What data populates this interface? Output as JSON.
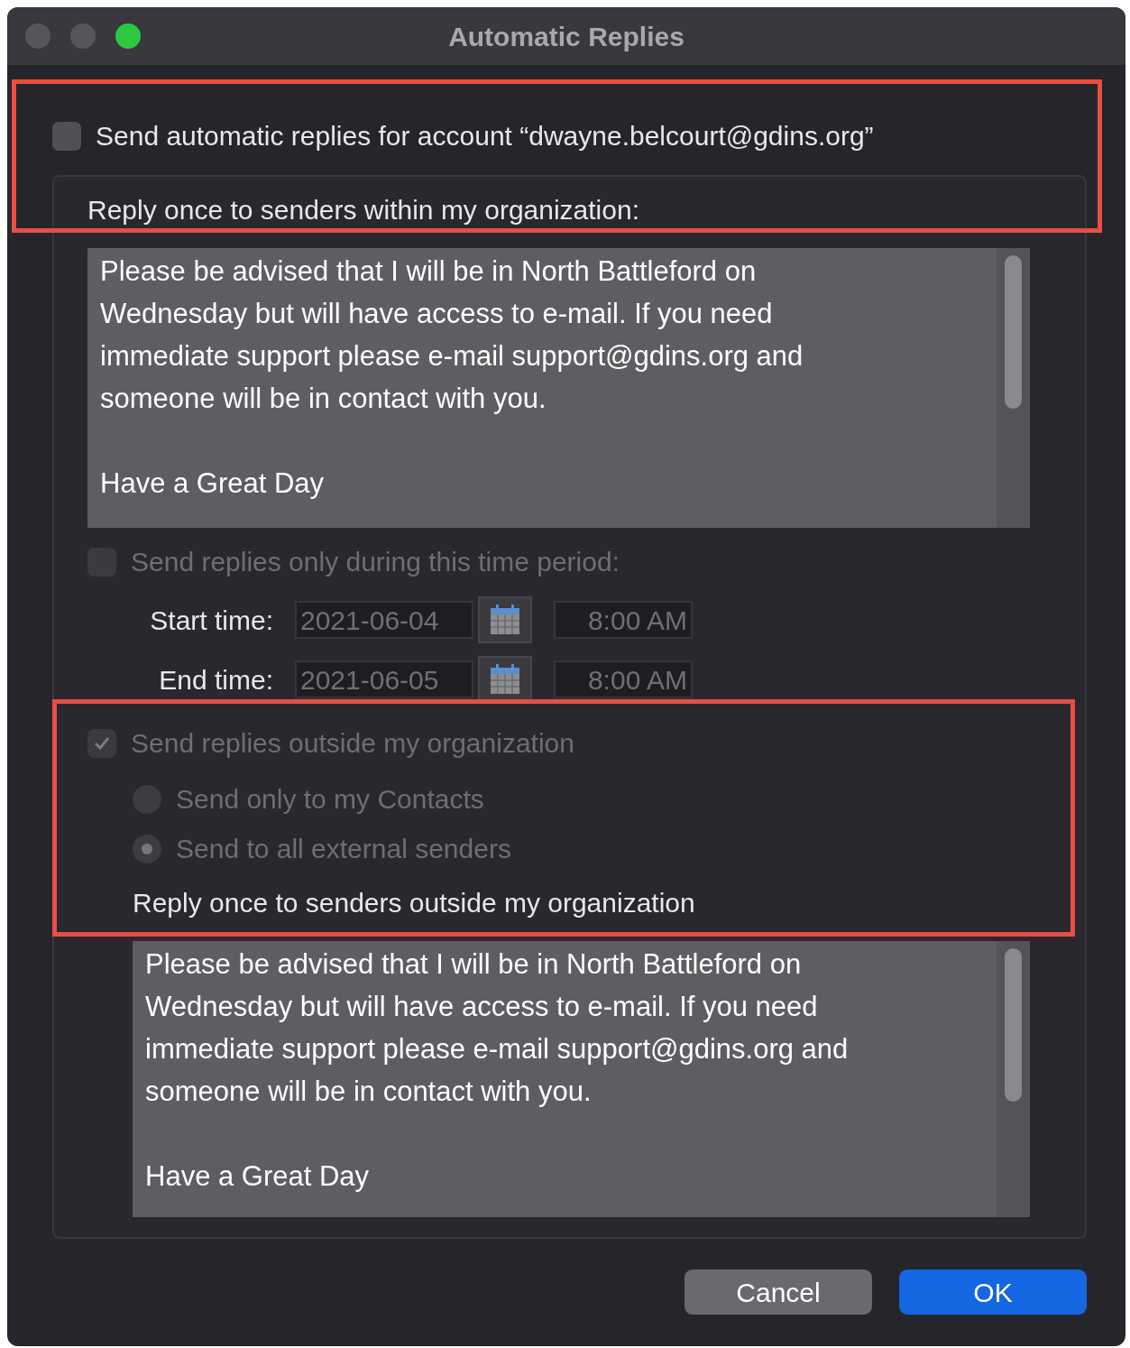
{
  "window": {
    "title": "Automatic Replies"
  },
  "send_automatic": {
    "label": "Send automatic replies for account “dwayne.belcourt@gdins.org”",
    "checked": false
  },
  "internal": {
    "label": "Reply once to senders within my organization:",
    "message": [
      "Please be advised that I will be in North Battleford on\nWednesday but will have access to e-mail. If you need\nimmediate support please e-mail support@gdins.org and\nsomeone will be in contact with you.",
      "Have a Great Day"
    ]
  },
  "time_period": {
    "label": "Send replies only during this time period:",
    "checked": false,
    "disabled": true,
    "rows": [
      {
        "label": "Start time:",
        "date": "2021-06-04",
        "time": "8:00 AM"
      },
      {
        "label": "End time:",
        "date": "2021-06-05",
        "time": "8:00 AM"
      }
    ]
  },
  "external": {
    "label": "Send replies outside my organization",
    "checked": true,
    "disabled": true,
    "options": [
      {
        "label": "Send only to my Contacts",
        "selected": false
      },
      {
        "label": "Send to all external senders",
        "selected": true
      }
    ],
    "reply_label": "Reply once to senders outside my organization",
    "message": [
      "Please be advised that I will be in North Battleford on\nWednesday but will have access to e-mail. If you need\nimmediate support please e-mail support@gdins.org and\nsomeone will be in contact with you.",
      "Have a Great Day"
    ]
  },
  "buttons": [
    {
      "label": "Cancel",
      "kind": "secondary"
    },
    {
      "label": "OK",
      "kind": "primary"
    }
  ]
}
